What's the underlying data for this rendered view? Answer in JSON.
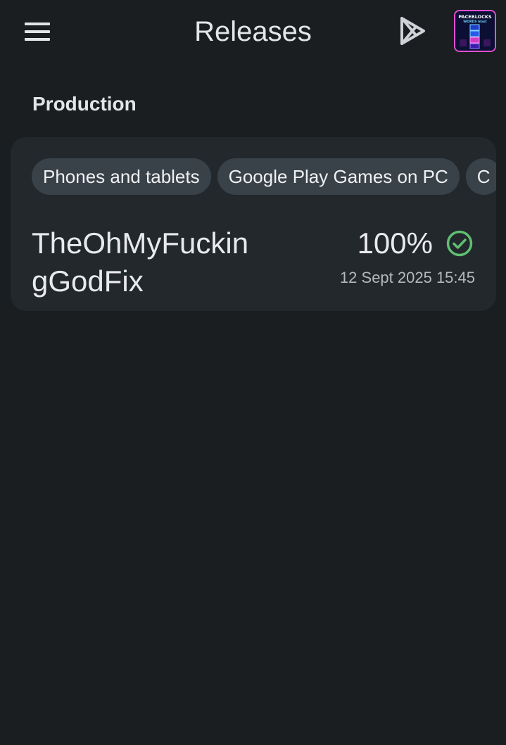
{
  "header": {
    "title": "Releases",
    "menu_icon": "menu-icon",
    "play_icon": "google-play-icon",
    "app_icon": {
      "name": "app-icon",
      "text_line1": "PACEBLOCKS",
      "text_line2": "WORDS blast"
    }
  },
  "section": {
    "title": "Production"
  },
  "release_card": {
    "chips": [
      {
        "label": "Phones and tablets"
      },
      {
        "label": "Google Play Games on PC"
      },
      {
        "label": "C"
      }
    ],
    "release_name": "TheOhMyFuckingGodFix",
    "rollout_percentage": "100%",
    "status_icon": "check-circle-icon",
    "status_color": "#5fbf71",
    "date": "12 Sept 2025 15:45"
  },
  "colors": {
    "background": "#1b1e21",
    "card": "#23282c",
    "chip": "#3a4249",
    "avatar_border": "#e24fd0"
  }
}
